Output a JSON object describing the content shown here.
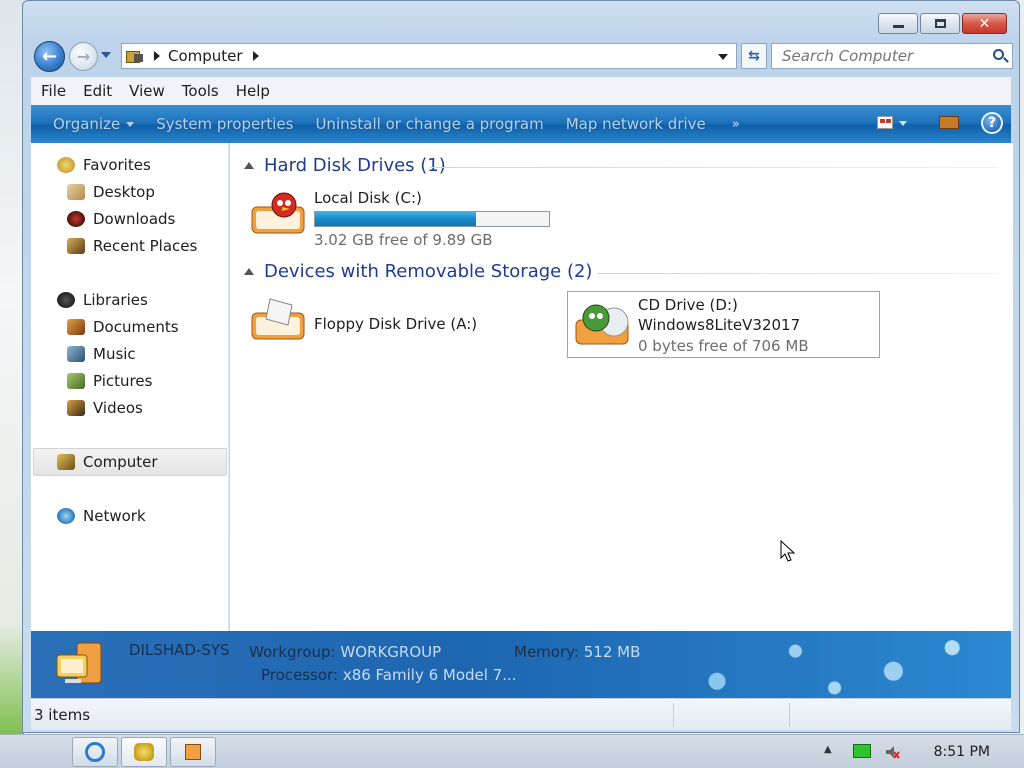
{
  "window": {
    "caption_buttons": {
      "minimize_icon": "minimize-icon",
      "maximize_icon": "maximize-icon",
      "close_icon": "close-icon",
      "close_glyph": "✕"
    }
  },
  "navigation": {
    "back_glyph": "←",
    "forward_glyph": "→",
    "breadcrumb": [
      "Computer"
    ],
    "refresh_glyph": "⇆",
    "search_placeholder": "Search Computer"
  },
  "menubar": {
    "items": [
      "File",
      "Edit",
      "View",
      "Tools",
      "Help"
    ]
  },
  "commandbar": {
    "items": [
      "Organize",
      "System properties",
      "Uninstall or change a program",
      "Map network drive"
    ],
    "more_glyph": "»",
    "help_glyph": "?"
  },
  "navpane": {
    "favorites": {
      "label": "Favorites",
      "items": [
        "Desktop",
        "Downloads",
        "Recent Places"
      ]
    },
    "libraries": {
      "label": "Libraries",
      "items": [
        "Documents",
        "Music",
        "Pictures",
        "Videos"
      ]
    },
    "computer": "Computer",
    "network": "Network"
  },
  "content": {
    "groups": [
      {
        "title": "Hard Disk Drives (1)",
        "drives": [
          {
            "name": "Local Disk (C:)",
            "free_text": "3.02 GB free of 9.89 GB",
            "used_fraction": 0.69
          }
        ]
      },
      {
        "title": "Devices with Removable Storage (2)",
        "drives": [
          {
            "name": "Floppy Disk Drive (A:)"
          },
          {
            "name": "CD Drive (D:)",
            "label": "Windows8LiteV32017",
            "free_text": "0 bytes free of 706 MB"
          }
        ]
      }
    ]
  },
  "details": {
    "computer_name": "DILSHAD-SYS",
    "workgroup_label": "Workgroup:",
    "workgroup_value": "WORKGROUP",
    "memory_label": "Memory:",
    "memory_value": "512 MB",
    "processor_label": "Processor:",
    "processor_value": "x86 Family 6 Model 7..."
  },
  "statusbar": {
    "text": "3 items"
  },
  "taskbar": {
    "time": "8:51 PM",
    "tray_up_glyph": "▲"
  },
  "colors": {
    "accent": "#1e73bd",
    "group_header": "#1e3d8f",
    "bar_fill": "#1a8ac8"
  }
}
